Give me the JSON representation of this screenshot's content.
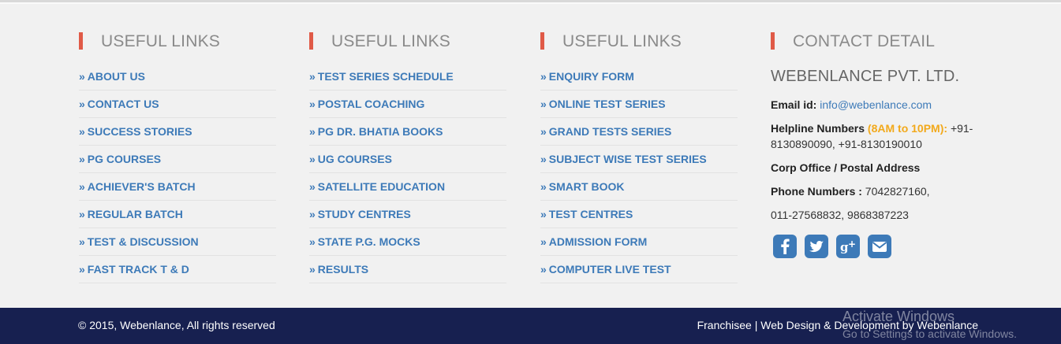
{
  "columns": [
    {
      "heading": "USEFUL LINKS",
      "links": [
        "ABOUT US",
        "CONTACT US",
        "SUCCESS STORIES",
        "PG COURSES",
        "ACHIEVER'S BATCH",
        "REGULAR BATCH",
        "TEST & DISCUSSION",
        "FAST TRACK T & D"
      ]
    },
    {
      "heading": "USEFUL LINKS",
      "links": [
        "TEST SERIES SCHEDULE",
        "POSTAL COACHING",
        "PG DR. BHATIA BOOKS",
        "UG COURSES",
        "SATELLITE EDUCATION",
        "STUDY CENTRES",
        "STATE P.G. MOCKS",
        "RESULTS"
      ]
    },
    {
      "heading": "USEFUL LINKS",
      "links": [
        "ENQUIRY FORM",
        "ONLINE TEST SERIES",
        "GRAND TESTS SERIES",
        "SUBJECT WISE TEST SERIES",
        "SMART BOOK",
        "TEST CENTRES",
        "ADMISSION FORM",
        "COMPUTER LIVE TEST"
      ]
    }
  ],
  "contact": {
    "heading": "CONTACT DETAIL",
    "company": "WEBENLANCE PVT. LTD.",
    "email_label": "Email id:",
    "email": "info@webenlance.com",
    "helpline_label": "Helpline Numbers",
    "helpline_hours": "(8AM to 10PM):",
    "helpline_numbers_1": "+91-",
    "helpline_numbers_2": "8130890090, +91-8130190010",
    "office_label": "Corp Office / Postal Address",
    "phone_label": "Phone Numbers :",
    "phone_1": "7042827160,",
    "phone_2": "011-27568832, 9868387223"
  },
  "social_icons": [
    "facebook-icon",
    "twitter-icon",
    "google-plus-icon",
    "envelope-icon"
  ],
  "footer": {
    "copyright": "© 2015, Webenlance, All rights reserved",
    "franchisee": "Franchisee",
    "separator": "|",
    "credit": "Web Design & Development by Webenlance"
  },
  "watermark": {
    "line1": "Activate Windows",
    "line2": "Go to Settings to activate Windows."
  },
  "colors": {
    "accent_bar": "#e05a47",
    "link": "#3d7ab8",
    "footer_bg": "#172050",
    "hours_highlight": "#f2a91b"
  }
}
